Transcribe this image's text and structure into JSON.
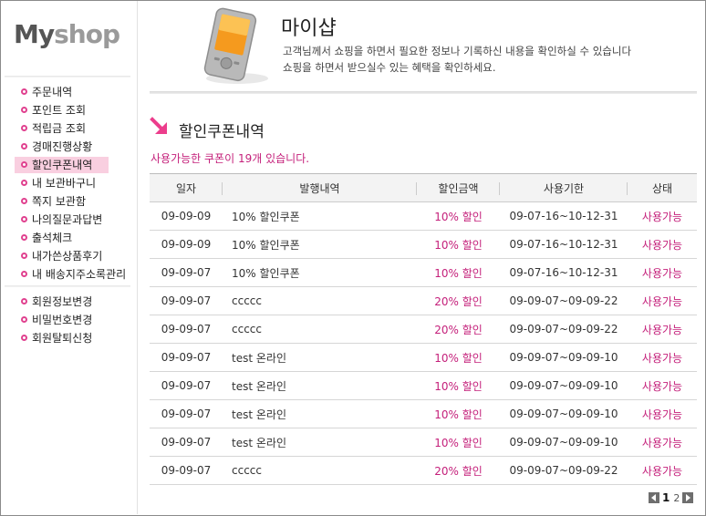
{
  "brand": {
    "logo_my": "My",
    "logo_shop": "shop"
  },
  "sidebar": {
    "group1": [
      {
        "label": "주문내역",
        "active": false
      },
      {
        "label": "포인트 조회",
        "active": false
      },
      {
        "label": "적립금 조회",
        "active": false
      },
      {
        "label": "경매진행상황",
        "active": false
      },
      {
        "label": "할인쿠폰내역",
        "active": true
      },
      {
        "label": "내 보관바구니",
        "active": false
      },
      {
        "label": "쪽지 보관함",
        "active": false
      },
      {
        "label": "나의질문과답변",
        "active": false
      },
      {
        "label": "출석체크",
        "active": false
      },
      {
        "label": "내가쓴상품후기",
        "active": false
      },
      {
        "label": "내 배송지주소록관리",
        "active": false
      }
    ],
    "group2": [
      {
        "label": "회원정보변경"
      },
      {
        "label": "비밀번호변경"
      },
      {
        "label": "회원탈퇴신청"
      }
    ]
  },
  "header": {
    "title": "마이샵",
    "desc_line1": "고객님께서 쇼핑을 하면서 필요한 정보나 기록하신 내용을 확인하실 수 있습니다",
    "desc_line2": "쇼핑을 하면서 받으실수 있는 혜택을 확인하세요."
  },
  "section": {
    "title": "할인쿠폰내역",
    "count_message": "사용가능한 쿠폰이 19개 있습니다."
  },
  "table": {
    "columns": [
      "일자",
      "발행내역",
      "할인금액",
      "사용기한",
      "상태"
    ],
    "rows": [
      {
        "date": "09-09-09",
        "issue": "10% 할인쿠폰",
        "discount": "10% 할인",
        "period": "09-07-16~10-12-31",
        "status": "사용가능"
      },
      {
        "date": "09-09-09",
        "issue": "10% 할인쿠폰",
        "discount": "10% 할인",
        "period": "09-07-16~10-12-31",
        "status": "사용가능"
      },
      {
        "date": "09-09-07",
        "issue": "10% 할인쿠폰",
        "discount": "10% 할인",
        "period": "09-07-16~10-12-31",
        "status": "사용가능"
      },
      {
        "date": "09-09-07",
        "issue": "ccccc",
        "discount": "20% 할인",
        "period": "09-09-07~09-09-22",
        "status": "사용가능"
      },
      {
        "date": "09-09-07",
        "issue": "ccccc",
        "discount": "20% 할인",
        "period": "09-09-07~09-09-22",
        "status": "사용가능"
      },
      {
        "date": "09-09-07",
        "issue": "test 온라인",
        "discount": "10% 할인",
        "period": "09-09-07~09-09-10",
        "status": "사용가능"
      },
      {
        "date": "09-09-07",
        "issue": "test 온라인",
        "discount": "10% 할인",
        "period": "09-09-07~09-09-10",
        "status": "사용가능"
      },
      {
        "date": "09-09-07",
        "issue": "test 온라인",
        "discount": "10% 할인",
        "period": "09-09-07~09-09-10",
        "status": "사용가능"
      },
      {
        "date": "09-09-07",
        "issue": "test 온라인",
        "discount": "10% 할인",
        "period": "09-09-07~09-09-10",
        "status": "사용가능"
      },
      {
        "date": "09-09-07",
        "issue": "ccccc",
        "discount": "20% 할인",
        "period": "09-09-07~09-09-22",
        "status": "사용가능"
      }
    ]
  },
  "pagination": {
    "pages": [
      "1",
      "2"
    ],
    "current": "1"
  },
  "icons": {
    "device": "pda-device-icon",
    "arrow": "arrow-down-right-icon",
    "bullet": "ring-bullet-icon"
  },
  "colors": {
    "accent": "#c41f7a",
    "bullet": "#e0418f",
    "active_bg": "#f9cfe0",
    "device_screen": "#f59a1e"
  }
}
